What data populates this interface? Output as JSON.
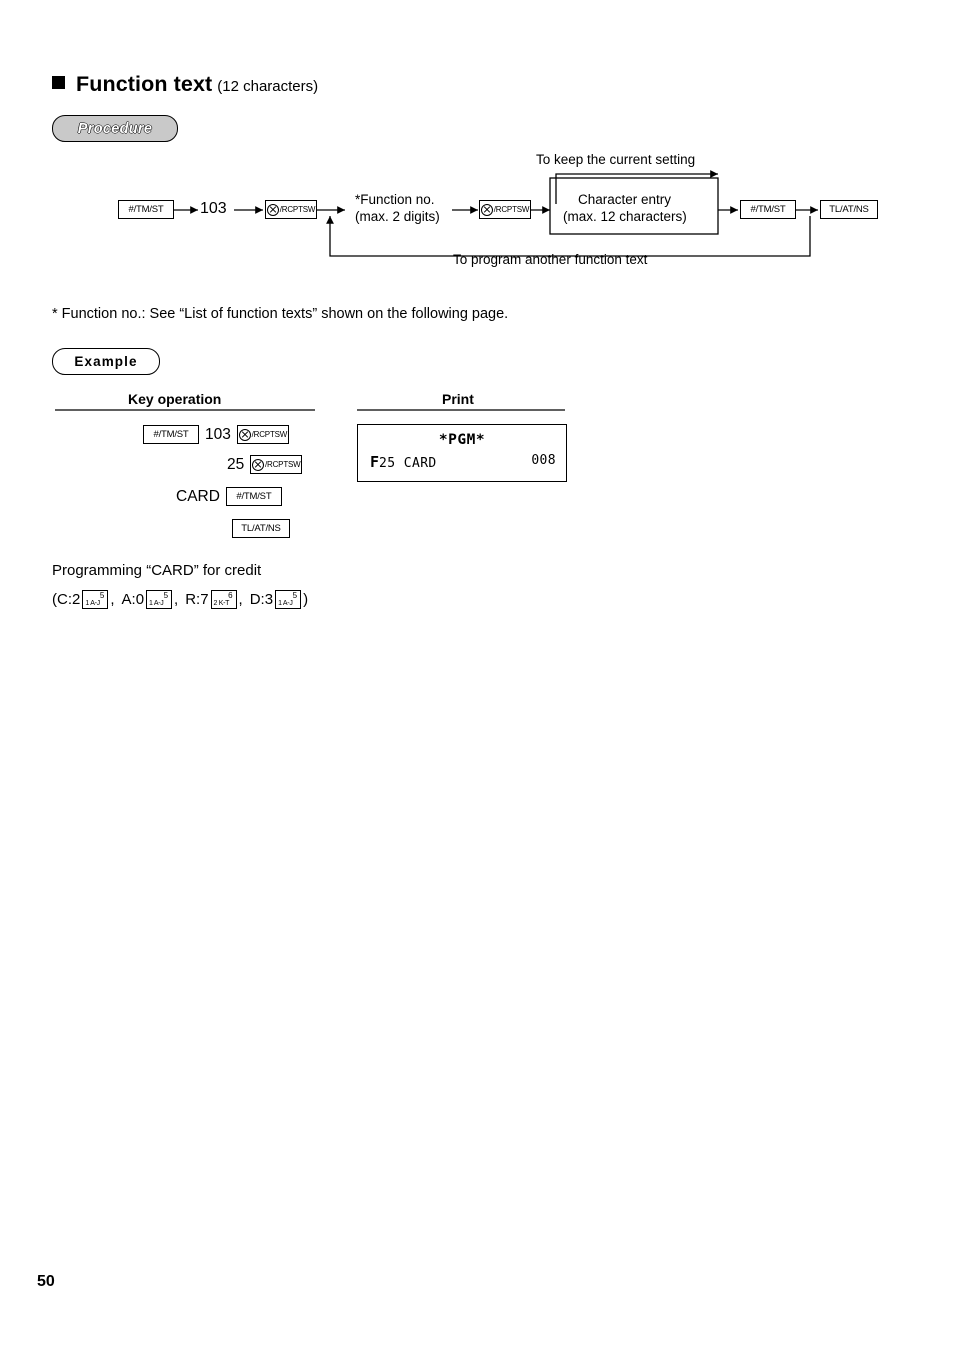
{
  "heading": {
    "title": "Function text",
    "subtitle": "(12 characters)"
  },
  "procedure": {
    "pill_label": "Procedure",
    "keep_setting_label": "To keep the current setting",
    "program_another_label": "To program another function text",
    "key_tm_st": "#/TM/ST",
    "key_rcptsw": "/RCPTSW",
    "number_103": "103",
    "function_no_line1": "*Function no.",
    "function_no_line2": "(max. 2 digits)",
    "char_entry_line1": "Character entry",
    "char_entry_line2": "(max. 12 characters)",
    "key_tl_at_ns": "TL/AT/NS"
  },
  "footnote": "* Function no.: See “List of function texts” shown on the following page.",
  "example": {
    "pill_label": "Example",
    "col_key_operation": "Key operation",
    "col_print": "Print",
    "rows": [
      {
        "text": "103",
        "keys": [
          "#/TM/ST",
          "/RCPTSW"
        ]
      },
      {
        "text": "25",
        "keys": [
          "/RCPTSW"
        ]
      },
      {
        "text": "CARD",
        "keys": [
          "#/TM/ST"
        ]
      },
      {
        "text": "",
        "keys": [
          "TL/AT/NS"
        ]
      }
    ],
    "print": {
      "title": "*PGM*",
      "left_prefix": "F",
      "left_code": "25",
      "left_text": "CARD",
      "right_value": "008"
    }
  },
  "note": {
    "line1": "Programming “CARD” for credit",
    "open_paren": "(",
    "items": [
      {
        "label": "C:2",
        "key_top": "5",
        "key_bottom": "1 A-J",
        "sep": ","
      },
      {
        "label": "A:0",
        "key_top": "5",
        "key_bottom": "1 A-J",
        "sep": ","
      },
      {
        "label": "R:7",
        "key_top": "6",
        "key_bottom": "2 K-T",
        "sep": ","
      },
      {
        "label": "D:3",
        "key_top": "5",
        "key_bottom": "1 A-J",
        "sep": ""
      }
    ],
    "close_paren": ")"
  },
  "page_number": "50"
}
